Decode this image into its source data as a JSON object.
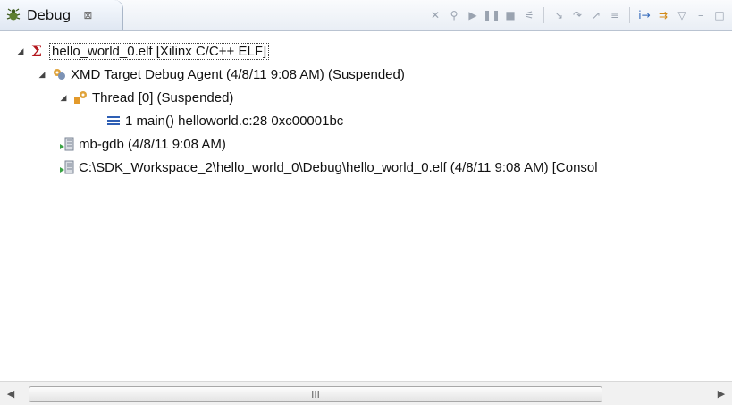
{
  "view": {
    "tab_label": "Debug",
    "tab_close": "⊠"
  },
  "toolbar": {
    "buttons": [
      {
        "name": "remove-all-terminated-icon",
        "glyph": "✕"
      },
      {
        "name": "connect-icon",
        "glyph": "⚲"
      },
      {
        "name": "resume-icon",
        "glyph": "▶"
      },
      {
        "name": "suspend-icon",
        "glyph": "❚❚"
      },
      {
        "name": "terminate-icon",
        "glyph": "■"
      },
      {
        "name": "disconnect-icon",
        "glyph": "⚟"
      },
      {
        "name": "step-into-icon",
        "glyph": "↘"
      },
      {
        "name": "step-over-icon",
        "glyph": "↷"
      },
      {
        "name": "step-return-icon",
        "glyph": "↗"
      },
      {
        "name": "drop-to-frame-icon",
        "glyph": "≡"
      },
      {
        "name": "instruction-stepping-icon",
        "glyph": "i→"
      },
      {
        "name": "use-step-filters-icon",
        "glyph": "⇉"
      },
      {
        "name": "view-menu-icon",
        "glyph": "▽"
      },
      {
        "name": "minimize-icon",
        "glyph": "–"
      },
      {
        "name": "maximize-icon",
        "glyph": "□"
      }
    ]
  },
  "tree": {
    "items": [
      {
        "label": "hello_world_0.elf [Xilinx C/C++ ELF]",
        "icon": "xilinx-sigma-icon",
        "level": 0,
        "expanded": true
      },
      {
        "label": "XMD Target Debug Agent (4/8/11 9:08 AM) (Suspended)",
        "icon": "debug-target-icon",
        "level": 1,
        "expanded": true
      },
      {
        "label": "Thread [0] (Suspended)",
        "icon": "thread-suspended-icon",
        "level": 2,
        "expanded": true
      },
      {
        "label": "1 main() helloworld.c:28 0xc00001bc",
        "icon": "stack-frame-icon",
        "level": 3,
        "expanded": null
      },
      {
        "label": "mb-gdb (4/8/11 9:08 AM)",
        "icon": "process-icon",
        "level": 1,
        "expanded": null
      },
      {
        "label": "C:\\SDK_Workspace_2\\hello_world_0\\Debug\\hello_world_0.elf (4/8/11 9:08 AM) [Consol",
        "icon": "process-icon",
        "level": 1,
        "expanded": null
      }
    ]
  },
  "scrollbar": {
    "grip": "III"
  }
}
